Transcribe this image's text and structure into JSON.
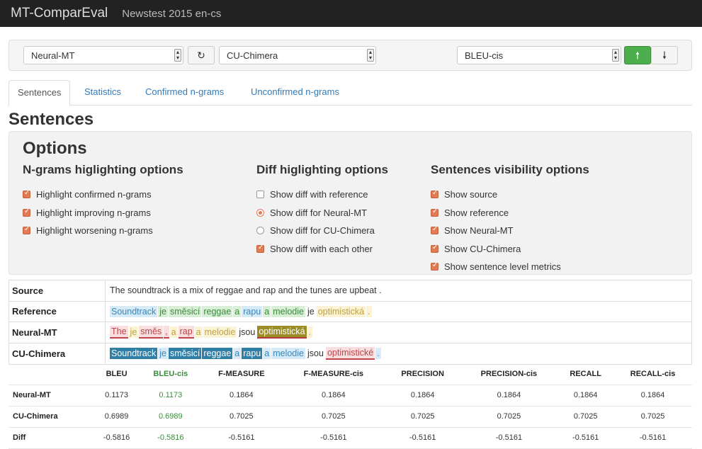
{
  "navbar": {
    "brand": "MT-ComparEval",
    "subtitle": "Newstest 2015 en-cs"
  },
  "toolbar": {
    "system1": "Neural-MT",
    "system2": "CU-Chimera",
    "metric": "BLEU-cis",
    "refresh_icon": "refresh-icon",
    "sort_up_icon": "arrow-up-icon",
    "sort_down_icon": "arrow-down-icon",
    "accent": "#4cae4c"
  },
  "tabs": [
    "Sentences",
    "Statistics",
    "Confirmed n-grams",
    "Unconfirmed n-grams"
  ],
  "page_title": "Sentences",
  "options": {
    "title": "Options",
    "ngrams": {
      "heading": "N-grams higlighting options",
      "items": [
        "Highlight confirmed n-grams",
        "Highlight improving n-grams",
        "Highlight worsening n-grams"
      ]
    },
    "diff": {
      "heading": "Diff higlighting options",
      "items": [
        "Show diff with reference",
        "Show diff for Neural-MT",
        "Show diff for CU-Chimera",
        "Show diff with each other"
      ]
    },
    "visibility": {
      "heading": "Sentences visibility options",
      "items": [
        "Show source",
        "Show reference",
        "Show Neural-MT",
        "Show CU-Chimera",
        "Show sentence level metrics"
      ]
    }
  },
  "sentences": {
    "labels": [
      "Source",
      "Reference",
      "Neural-MT",
      "CU-Chimera"
    ],
    "source": "The soundtrack is a mix of reggae and rap and the tunes are upbeat .",
    "reference": [
      {
        "t": "Soundtrack",
        "c": "blue"
      },
      {
        "t": "je",
        "c": "green"
      },
      {
        "t": "směsicí",
        "c": "green"
      },
      {
        "t": "reggae",
        "c": "green"
      },
      {
        "t": "a",
        "c": "green"
      },
      {
        "t": "rapu",
        "c": "blue"
      },
      {
        "t": "a",
        "c": "green"
      },
      {
        "t": "melodie",
        "c": "green"
      },
      {
        "t": "je",
        "c": "none"
      },
      {
        "t": "optimistická",
        "c": "yellow"
      },
      {
        "t": ".",
        "c": "yellow"
      }
    ],
    "neural": [
      {
        "t": "The",
        "c": "red"
      },
      {
        "t": "je",
        "c": "yellow"
      },
      {
        "t": "směs",
        "c": "red"
      },
      {
        "t": ",",
        "c": "red"
      },
      {
        "t": "a",
        "c": "yellow"
      },
      {
        "t": "rap",
        "c": "red"
      },
      {
        "t": "a",
        "c": "yellow"
      },
      {
        "t": "melodie",
        "c": "yellow"
      },
      {
        "t": "jsou",
        "c": "none"
      },
      {
        "t": "optimistická",
        "c": "olive"
      },
      {
        "t": ".",
        "c": "yellow"
      }
    ],
    "chimera": [
      {
        "t": "Soundtrack",
        "c": "teal"
      },
      {
        "t": "je",
        "c": "lightblue"
      },
      {
        "t": "směsicí",
        "c": "teal"
      },
      {
        "t": "reggae",
        "c": "teal"
      },
      {
        "t": "a",
        "c": "lightblue"
      },
      {
        "t": "rapu",
        "c": "teal"
      },
      {
        "t": "a",
        "c": "lightblue"
      },
      {
        "t": "melodie",
        "c": "lightblue"
      },
      {
        "t": "jsou",
        "c": "none"
      },
      {
        "t": "optimistické",
        "c": "red"
      },
      {
        "t": ".",
        "c": "lightblue"
      }
    ]
  },
  "metrics": {
    "headers": [
      "",
      "BLEU",
      "BLEU-cis",
      "F-MEASURE",
      "F-MEASURE-cis",
      "PRECISION",
      "PRECISION-cis",
      "RECALL",
      "RECALL-cis"
    ],
    "rows": [
      [
        "Neural-MT",
        "0.1173",
        "0.1173",
        "0.1864",
        "0.1864",
        "0.1864",
        "0.1864",
        "0.1864",
        "0.1864"
      ],
      [
        "CU-Chimera",
        "0.6989",
        "0.6989",
        "0.7025",
        "0.7025",
        "0.7025",
        "0.7025",
        "0.7025",
        "0.7025"
      ],
      [
        "Diff",
        "-0.5816",
        "-0.5816",
        "-0.5161",
        "-0.5161",
        "-0.5161",
        "-0.5161",
        "-0.5161",
        "-0.5161"
      ]
    ]
  }
}
